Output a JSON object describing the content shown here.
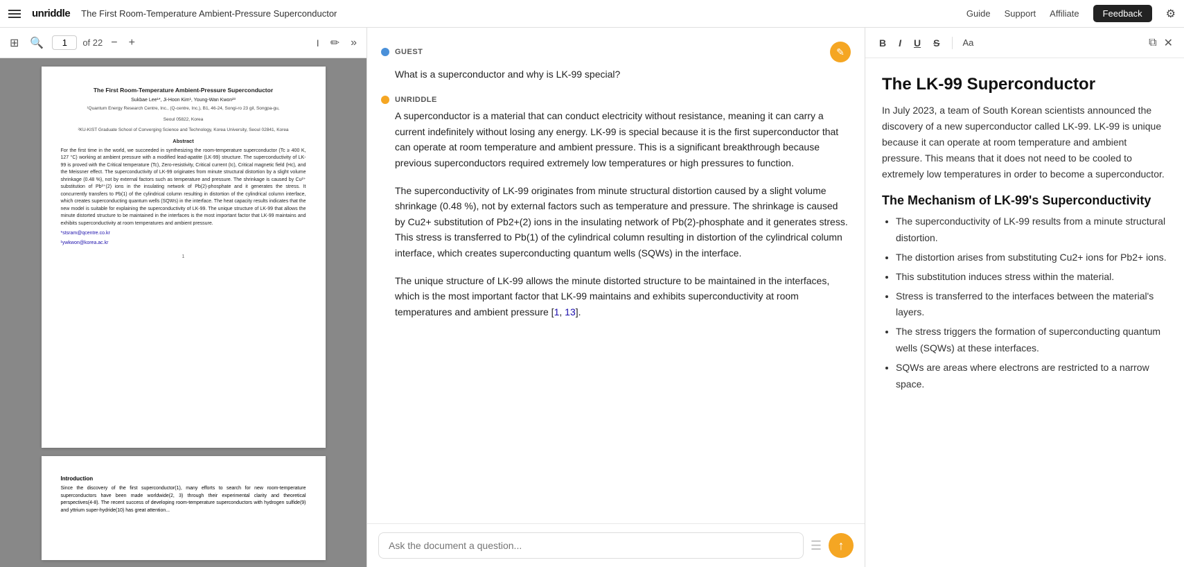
{
  "nav": {
    "hamburger_label": "menu",
    "logo": "unriddle",
    "title": "The First Room-Temperature Ambient-Pressure Superconductor",
    "links": [
      "Guide",
      "Support",
      "Affiliate"
    ],
    "feedback_label": "Feedback",
    "gear_label": "settings"
  },
  "pdf": {
    "page_current": "1",
    "page_total": "of 22",
    "toolbar": {
      "sidebar_icon": "sidebar",
      "search_icon": "search",
      "minus_icon": "zoom-out",
      "plus_icon": "zoom-in",
      "cursor_icon": "cursor",
      "pen_icon": "pen",
      "more_icon": "more"
    },
    "page1": {
      "title": "The First Room-Temperature Ambient-Pressure Superconductor",
      "authors": "Sukbae Lee¹*, Ji-Hoon Kim¹, Young-Wan Kwon²³",
      "affil1": "¹Quantum Energy Research Centre, Inc., (Q-centre, Inc.), B1, 46-24, Songi-ro 23 gil, Songpa-gu,",
      "affil2": "Seoul 05822, Korea",
      "affil3": "²KU-KIST Graduate School of Converging Science and Technology, Korea University, Seoul 02841, Korea",
      "abstract_title": "Abstract",
      "abstract_body": "For the first time in the world, we succeeded in synthesizing the room-temperature superconductor (Tc ≥ 400 K, 127 °C) working at ambient pressure with a modified lead-apatite (LK-99) structure. The superconductivity of LK-99 is proved with the Critical temperature (Tc), Zero-resistivity, Critical current (Ic), Critical magnetic field (Hc), and the Meissner effect. The superconductivity of LK-99 originates from minute structural distortion by a slight volume shrinkage (0.48 %), not by external factors such as temperature and pressure. The shrinkage is caused by Cu²⁺ substitution of Pb²⁺(2) ions in the insulating network of Pb(2)-phosphate and it generates the stress. It concurrently transfers to Pb(1) of the cylindrical column resulting in distortion of the cylindrical column interface, which creates superconducting quantum wells (SQWs) in the interface. The heat capacity results indicates that the new model is suitable for explaining the superconductivity of LK-99. The unique structure of LK-99 that allows the minute distorted structure to be maintained in the interfaces is the most important factor that LK-99 maintains and exhibits superconductivity at room temperatures and ambient pressure.",
      "link1": "*stsram@qcentre.co.kr",
      "link2": "¹ywkwon@korea.ac.kr",
      "page_num": "1"
    },
    "page2": {
      "section_title": "Introduction",
      "body": "Since the discovery of the first superconductor(1), many efforts to search for new room-temperature superconductors have been made worldwide(2, 3) through their experimental clarity and theoretical perspectives(4-8). The recent success of developing room-temperature superconductors with hydrogen sulfide(9) and yttrium super-hydride(10) has great attention..."
    }
  },
  "chat": {
    "messages": [
      {
        "role": "guest",
        "sender": "GUEST",
        "text": "What is a superconductor and why is LK-99 special?",
        "has_edit": true
      },
      {
        "role": "ai",
        "sender": "UNRIDDLE",
        "paragraphs": [
          "A superconductor is a material that can conduct electricity without resistance, meaning it can carry a current indefinitely without losing any energy. LK-99 is special because it is the first superconductor that can operate at room temperature and ambient pressure. This is a significant breakthrough because previous superconductors required extremely low temperatures or high pressures to function.",
          "The superconductivity of LK-99 originates from minute structural distortion caused by a slight volume shrinkage (0.48 %), not by external factors such as temperature and pressure. The shrinkage is caused by Cu2+ substitution of Pb2+(2) ions in the insulating network of Pb(2)-phosphate and it generates stress. This stress is transferred to Pb(1) of the cylindrical column resulting in distortion of the cylindrical column interface, which creates superconducting quantum wells (SQWs) in the interface.",
          "The unique structure of LK-99 allows the minute distorted structure to be maintained in the interfaces, which is the most important factor that LK-99 maintains and exhibits superconductivity at room temperatures and ambient pressure [1, 13]."
        ],
        "has_edit": false
      }
    ],
    "input_placeholder": "Ask the document a question...",
    "send_label": "send"
  },
  "notes": {
    "toolbar": {
      "bold_label": "B",
      "italic_label": "I",
      "underline_label": "U",
      "strikethrough_label": "S",
      "font_label": "Aa",
      "copy_icon": "copy",
      "close_icon": "close"
    },
    "heading": "The LK-99 Superconductor",
    "intro": "In July 2023, a team of South Korean scientists announced the discovery of a new superconductor called LK-99. LK-99 is unique because it can operate at room temperature and ambient pressure. This means that it does not need to be cooled to extremely low temperatures in order to become a superconductor.",
    "section2_heading": "The Mechanism of LK-99's Superconductivity",
    "bullets": [
      "The superconductivity of LK-99 results from a minute structural distortion.",
      "The distortion arises from substituting Cu2+ ions for Pb2+ ions.",
      "This substitution induces stress within the material.",
      "Stress is transferred to the interfaces between the material's layers.",
      "The stress triggers the formation of superconducting quantum wells (SQWs) at these interfaces.",
      "SQWs are areas where electrons are restricted to a narrow space."
    ]
  }
}
